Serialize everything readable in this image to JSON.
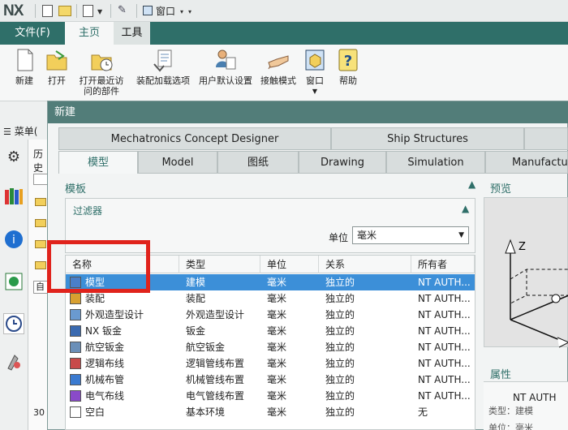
{
  "app": {
    "logo": "NX",
    "window_label": "窗口"
  },
  "ribbon_tabs": {
    "file": "文件(F)",
    "home": "主页",
    "tools": "工具"
  },
  "ribbon": {
    "new": "新建",
    "open": "打开",
    "open_recent_line1": "打开最近访",
    "open_recent_line2": "问的部件",
    "assembly_load_options": "装配加载选项",
    "user_defaults": "用户默认设置",
    "touch_mode": "接触模式",
    "window": "窗口",
    "help": "帮助"
  },
  "left": {
    "menu": "菜单(",
    "history": "历史",
    "panel_letter": "自",
    "panel_number": "30"
  },
  "dialog": {
    "title": "新建",
    "top_tabs": [
      "Mechatronics Concept Designer",
      "Ship Structures"
    ],
    "tabs": [
      "模型",
      "Model",
      "图纸",
      "Drawing",
      "Simulation",
      "Manufacturi"
    ],
    "template_section": "模板",
    "preview_section": "预览",
    "filter_section": "过滤器",
    "unit_label": "单位",
    "unit_value": "毫米",
    "properties_section": "属性",
    "properties_owner": "NT AUTH",
    "properties_lines": [
      "类型：建模",
      "单位：毫米"
    ],
    "preview_axis_label": "Z",
    "columns": [
      "名称",
      "类型",
      "单位",
      "关系",
      "所有者"
    ],
    "rows": [
      {
        "name": "模型",
        "type": "建模",
        "unit": "毫米",
        "relation": "独立的",
        "owner": "NT AUTH...",
        "selected": true
      },
      {
        "name": "装配",
        "type": "装配",
        "unit": "毫米",
        "relation": "独立的",
        "owner": "NT AUTH..."
      },
      {
        "name": "外观造型设计",
        "type": "外观造型设计",
        "unit": "毫米",
        "relation": "独立的",
        "owner": "NT AUTH..."
      },
      {
        "name": "NX 钣金",
        "type": "钣金",
        "unit": "毫米",
        "relation": "独立的",
        "owner": "NT AUTH..."
      },
      {
        "name": "航空钣金",
        "type": "航空钣金",
        "unit": "毫米",
        "relation": "独立的",
        "owner": "NT AUTH..."
      },
      {
        "name": "逻辑布线",
        "type": "逻辑管线布置",
        "unit": "毫米",
        "relation": "独立的",
        "owner": "NT AUTH..."
      },
      {
        "name": "机械布管",
        "type": "机械管线布置",
        "unit": "毫米",
        "relation": "独立的",
        "owner": "NT AUTH..."
      },
      {
        "name": "电气布线",
        "type": "电气管线布置",
        "unit": "毫米",
        "relation": "独立的",
        "owner": "NT AUTH..."
      },
      {
        "name": "空白",
        "type": "基本环境",
        "unit": "毫米",
        "relation": "独立的",
        "owner": "无"
      }
    ]
  },
  "colors": {
    "ribbon_tab_bg": "#2f6f69",
    "dialog_title_bg": "#527d79",
    "selection": "#3c8fd8",
    "annotation": "#e0231c"
  }
}
